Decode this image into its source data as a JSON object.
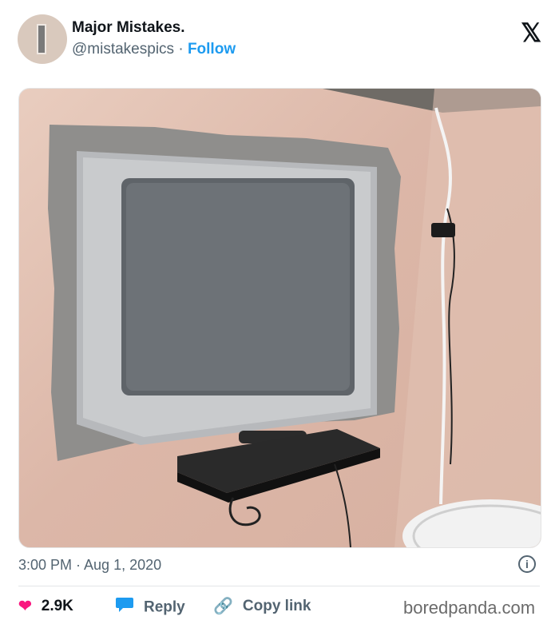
{
  "account": {
    "display_name": "Major Mistakes.",
    "handle": "@mistakespics",
    "separator": "·",
    "follow_label": "Follow"
  },
  "brand_icon": "x-logo",
  "brand_glyph": "𝕏",
  "media": {
    "description_icon": "photo"
  },
  "timestamp": "3:00 PM · Aug 1, 2020",
  "info_glyph": "i",
  "actions": {
    "like_count": "2.9K",
    "reply_label": "Reply",
    "copy_link_label": "Copy link"
  },
  "watermark": "boredpanda.com",
  "colors": {
    "accent": "#1d9bf0",
    "like": "#f91880",
    "muted": "#536471"
  }
}
